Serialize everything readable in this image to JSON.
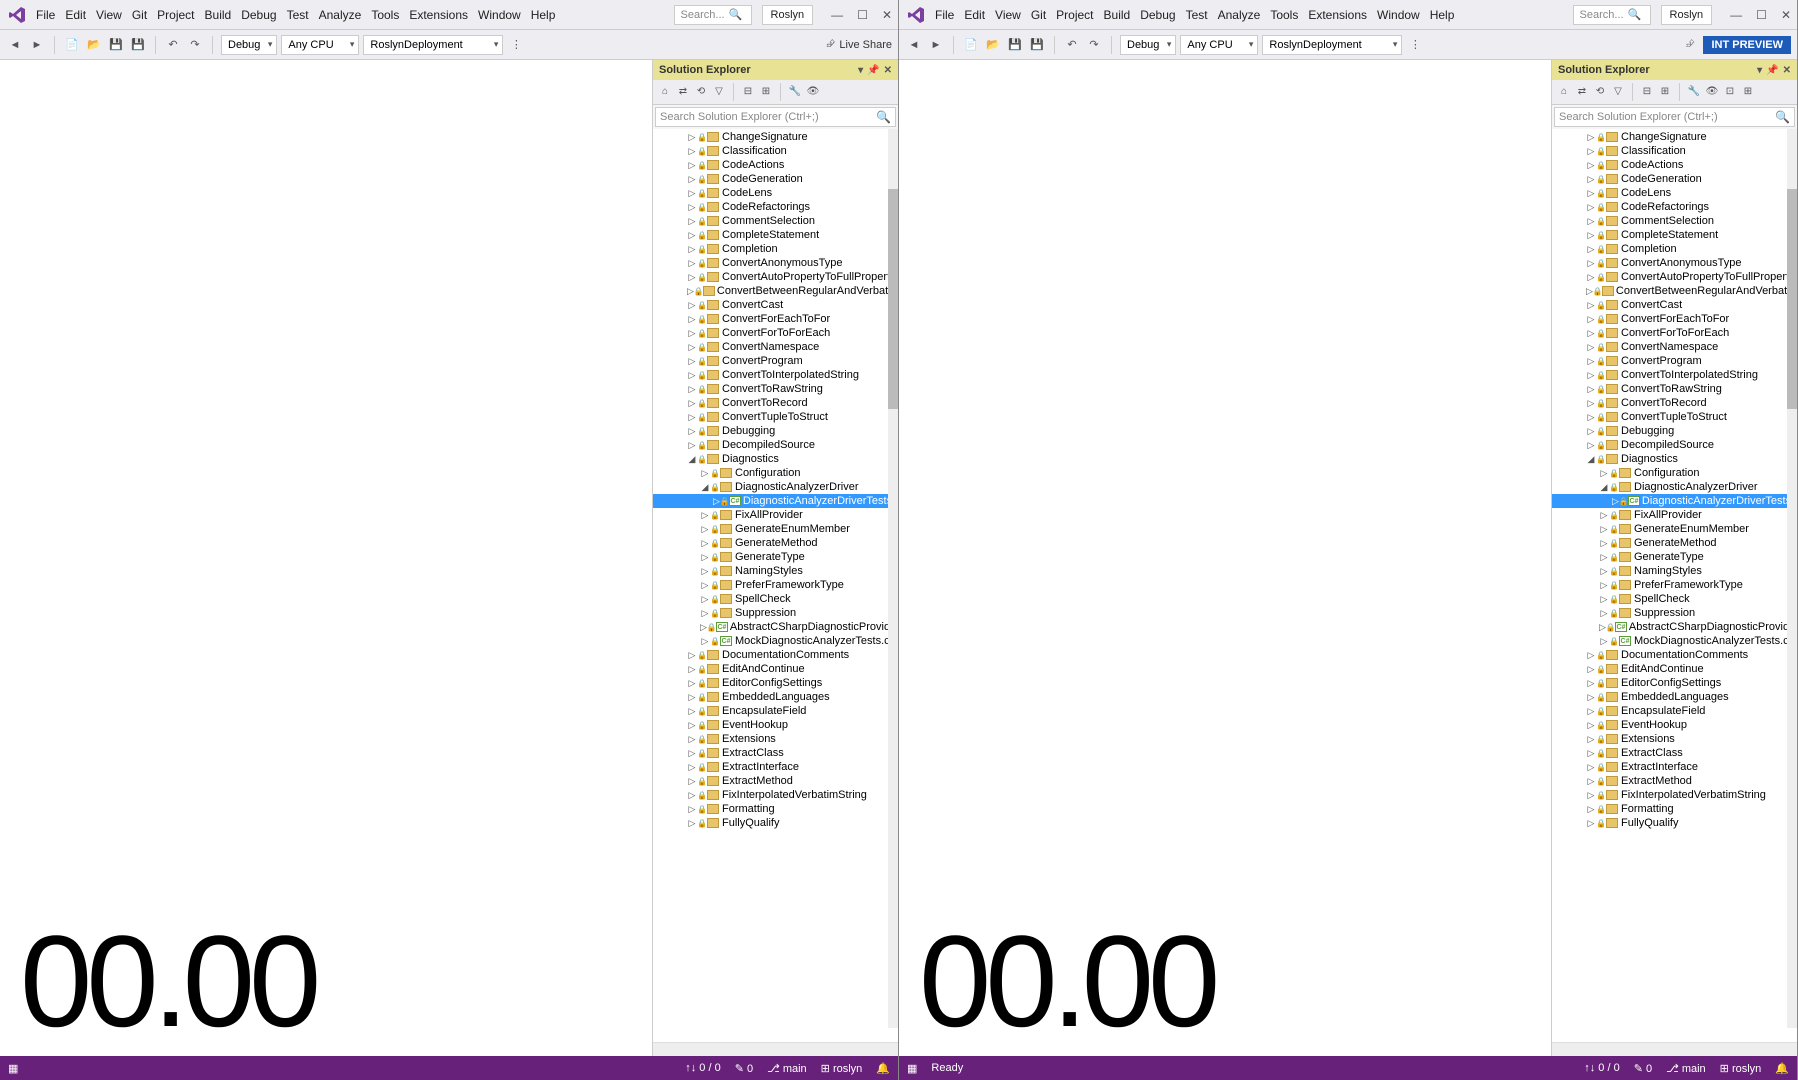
{
  "menu": [
    "File",
    "Edit",
    "View",
    "Git",
    "Project",
    "Build",
    "Debug",
    "Test",
    "Analyze",
    "Tools",
    "Extensions",
    "Window",
    "Help"
  ],
  "search_placeholder": "Search...",
  "solution_name": "Roslyn",
  "combo_config": "Debug",
  "combo_platform": "Any CPU",
  "combo_target": "RoslynDeployment",
  "live_share": "Live Share",
  "preview_label": "INT PREVIEW",
  "se_title": "Solution Explorer",
  "se_search_placeholder": "Search Solution Explorer (Ctrl+;)",
  "timer": "00.00",
  "status_left_ready": "Ready",
  "status_counts": "0 / 0",
  "status_pencil": "0",
  "status_branch": "main",
  "status_repo": "roslyn",
  "tree": [
    {
      "t": "folder",
      "n": "ChangeSignature",
      "d": 2
    },
    {
      "t": "folder",
      "n": "Classification",
      "d": 2
    },
    {
      "t": "folder",
      "n": "CodeActions",
      "d": 2
    },
    {
      "t": "folder",
      "n": "CodeGeneration",
      "d": 2
    },
    {
      "t": "folder",
      "n": "CodeLens",
      "d": 2
    },
    {
      "t": "folder",
      "n": "CodeRefactorings",
      "d": 2
    },
    {
      "t": "folder",
      "n": "CommentSelection",
      "d": 2
    },
    {
      "t": "folder",
      "n": "CompleteStatement",
      "d": 2
    },
    {
      "t": "folder",
      "n": "Completion",
      "d": 2
    },
    {
      "t": "folder",
      "n": "ConvertAnonymousType",
      "d": 2
    },
    {
      "t": "folder",
      "n": "ConvertAutoPropertyToFullProperty",
      "d": 2
    },
    {
      "t": "folder",
      "n": "ConvertBetweenRegularAndVerbatimString",
      "d": 2
    },
    {
      "t": "folder",
      "n": "ConvertCast",
      "d": 2
    },
    {
      "t": "folder",
      "n": "ConvertForEachToFor",
      "d": 2
    },
    {
      "t": "folder",
      "n": "ConvertForToForEach",
      "d": 2
    },
    {
      "t": "folder",
      "n": "ConvertNamespace",
      "d": 2
    },
    {
      "t": "folder",
      "n": "ConvertProgram",
      "d": 2
    },
    {
      "t": "folder",
      "n": "ConvertToInterpolatedString",
      "d": 2
    },
    {
      "t": "folder",
      "n": "ConvertToRawString",
      "d": 2
    },
    {
      "t": "folder",
      "n": "ConvertToRecord",
      "d": 2
    },
    {
      "t": "folder",
      "n": "ConvertTupleToStruct",
      "d": 2
    },
    {
      "t": "folder",
      "n": "Debugging",
      "d": 2
    },
    {
      "t": "folder",
      "n": "DecompiledSource",
      "d": 2
    },
    {
      "t": "folder",
      "n": "Diagnostics",
      "d": 2,
      "open": true
    },
    {
      "t": "folder",
      "n": "Configuration",
      "d": 3
    },
    {
      "t": "folder",
      "n": "DiagnosticAnalyzerDriver",
      "d": 3,
      "open": true
    },
    {
      "t": "cs",
      "n": "DiagnosticAnalyzerDriverTests.cs",
      "d": 4,
      "sel": true
    },
    {
      "t": "folder",
      "n": "FixAllProvider",
      "d": 3
    },
    {
      "t": "folder",
      "n": "GenerateEnumMember",
      "d": 3
    },
    {
      "t": "folder",
      "n": "GenerateMethod",
      "d": 3
    },
    {
      "t": "folder",
      "n": "GenerateType",
      "d": 3
    },
    {
      "t": "folder",
      "n": "NamingStyles",
      "d": 3
    },
    {
      "t": "folder",
      "n": "PreferFrameworkType",
      "d": 3
    },
    {
      "t": "folder",
      "n": "SpellCheck",
      "d": 3
    },
    {
      "t": "folder",
      "n": "Suppression",
      "d": 3
    },
    {
      "t": "cs",
      "n": "AbstractCSharpDiagnosticProviderBasedUserDiagnosticTest.cs",
      "d": 3
    },
    {
      "t": "cs",
      "n": "MockDiagnosticAnalyzerTests.cs",
      "d": 3
    },
    {
      "t": "folder",
      "n": "DocumentationComments",
      "d": 2
    },
    {
      "t": "folder",
      "n": "EditAndContinue",
      "d": 2
    },
    {
      "t": "folder",
      "n": "EditorConfigSettings",
      "d": 2
    },
    {
      "t": "folder",
      "n": "EmbeddedLanguages",
      "d": 2
    },
    {
      "t": "folder",
      "n": "EncapsulateField",
      "d": 2
    },
    {
      "t": "folder",
      "n": "EventHookup",
      "d": 2
    },
    {
      "t": "folder",
      "n": "Extensions",
      "d": 2
    },
    {
      "t": "folder",
      "n": "ExtractClass",
      "d": 2
    },
    {
      "t": "folder",
      "n": "ExtractInterface",
      "d": 2
    },
    {
      "t": "folder",
      "n": "ExtractMethod",
      "d": 2
    },
    {
      "t": "folder",
      "n": "FixInterpolatedVerbatimString",
      "d": 2
    },
    {
      "t": "folder",
      "n": "Formatting",
      "d": 2
    },
    {
      "t": "folder",
      "n": "FullyQualify",
      "d": 2
    }
  ]
}
